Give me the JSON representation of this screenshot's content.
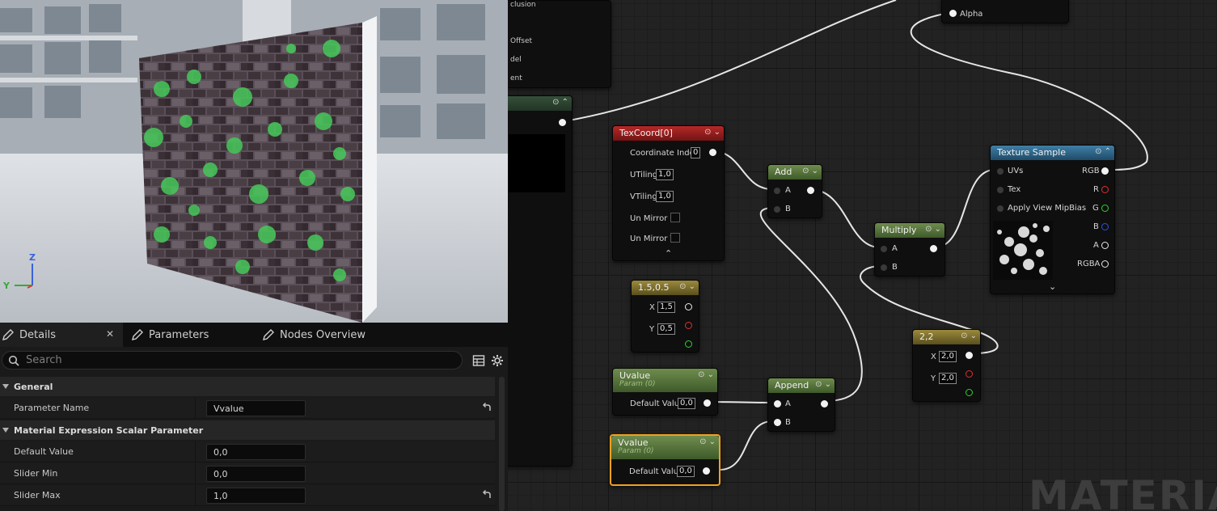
{
  "details": {
    "tabs": [
      {
        "label": "Details",
        "active": true
      },
      {
        "label": "Parameters",
        "active": false
      },
      {
        "label": "Nodes Overview",
        "active": false
      }
    ],
    "close_glyph": "✕",
    "search_placeholder": "Search",
    "categories": [
      {
        "label": "General"
      },
      {
        "label": "Material Expression Scalar Parameter"
      }
    ],
    "rows": [
      {
        "label": "Parameter Name",
        "value": "Vvalue"
      },
      {
        "label": "Default Value",
        "value": "0,0"
      },
      {
        "label": "Slider Min",
        "value": "0,0"
      },
      {
        "label": "Slider Max",
        "value": "1,0"
      }
    ]
  },
  "viewport": {
    "axis_z": "Z",
    "axis_y": "Y"
  },
  "graph": {
    "watermark": "MATERIA",
    "partial_labels": [
      "clusion",
      "Offset",
      "del",
      "ent"
    ],
    "main_node": {
      "pin_alpha": "Alpha"
    },
    "texcoord": {
      "title": "TexCoord[0]",
      "coordinate_index_label": "Coordinate Index",
      "coordinate_index": "0",
      "utiling_label": "UTiling",
      "utiling": "1,0",
      "vtiling_label": "VTiling",
      "vtiling": "1,0",
      "unmirror_u": "Un Mirror U",
      "unmirror_v": "Un Mirror V"
    },
    "add": {
      "title": "Add",
      "a": "A",
      "b": "B"
    },
    "multiply": {
      "title": "Multiply",
      "a": "A",
      "b": "B"
    },
    "append": {
      "title": "Append",
      "a": "A",
      "b": "B"
    },
    "const_15": {
      "title": "1.5,0.5",
      "x_label": "X",
      "x": "1,5",
      "y_label": "Y",
      "y": "0,5"
    },
    "const_22": {
      "title": "2,2",
      "x_label": "X",
      "x": "2,0",
      "y_label": "Y",
      "y": "2,0"
    },
    "uvalue": {
      "title": "Uvalue",
      "subtitle": "Param (0)",
      "default_label": "Default Value",
      "default_value": "0,0"
    },
    "vvalue": {
      "title": "Vvalue",
      "subtitle": "Param (0)",
      "default_label": "Default Value",
      "default_value": "0,0"
    },
    "texture_sample": {
      "title": "Texture Sample",
      "uvs": "UVs",
      "tex": "Tex",
      "mipbias": "Apply View MipBias",
      "rgb": "RGB",
      "r": "R",
      "g": "G",
      "b": "B",
      "a": "A",
      "rgba": "RGBA"
    }
  }
}
